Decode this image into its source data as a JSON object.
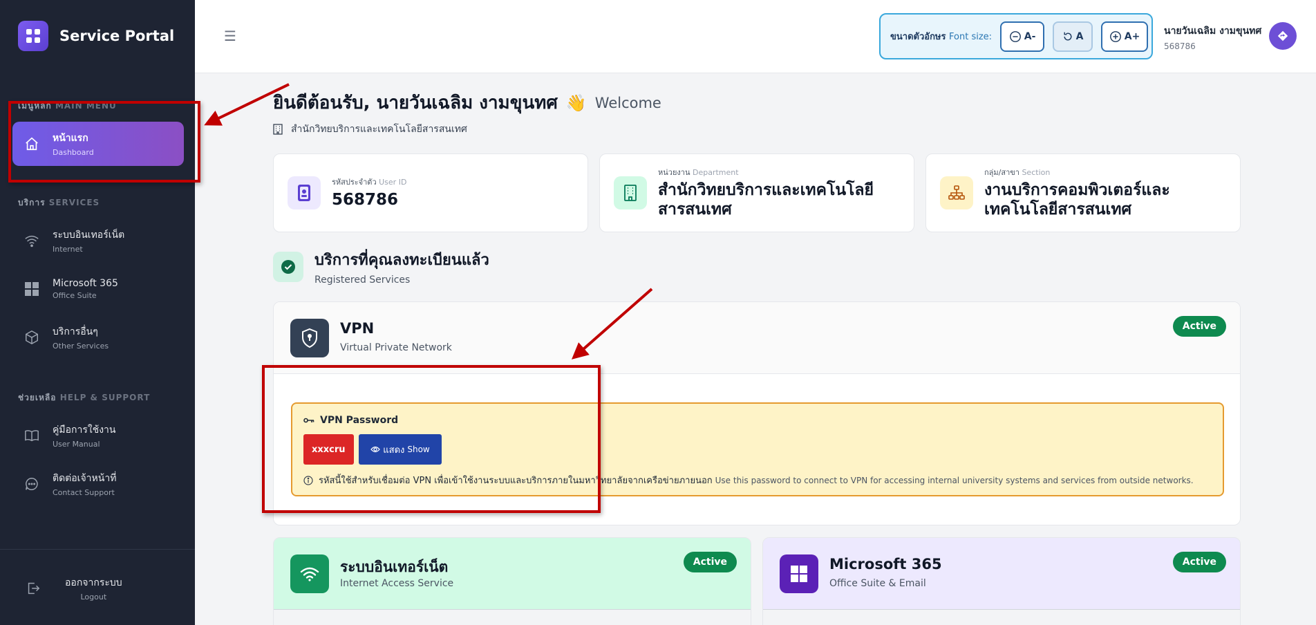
{
  "sidebar": {
    "brand": "Service Portal",
    "main_menu_th": "เมนูหลัก",
    "main_menu_en": "MAIN MENU",
    "services_th": "บริการ",
    "services_en": "SERVICES",
    "help_th": "ช่วยเหลือ",
    "help_en": "HELP & SUPPORT",
    "items": [
      {
        "label": "หน้าแรก",
        "sub": "Dashboard",
        "icon": "home-icon",
        "active": true
      },
      {
        "label": "ระบบอินเทอร์เน็ต",
        "sub": "Internet",
        "icon": "wifi-icon"
      },
      {
        "label": "Microsoft 365",
        "sub": "Office Suite",
        "icon": "windows-icon"
      },
      {
        "label": "บริการอื่นๆ",
        "sub": "Other Services",
        "icon": "box-icon"
      },
      {
        "label": "คู่มือการใช้งาน",
        "sub": "User Manual",
        "icon": "book-icon"
      },
      {
        "label": "ติดต่อเจ้าหน้าที่",
        "sub": "Contact Support",
        "icon": "chat-icon"
      }
    ],
    "logout_label": "ออกจากระบบ",
    "logout_sub": "Logout"
  },
  "header": {
    "font_size_th": "ขนาดตัวอักษร",
    "font_size_en": "Font size:",
    "btn_decrease": "A-",
    "btn_reset": "A",
    "btn_increase": "A+",
    "user_name": "นายวันเฉลิม งามขุนทศ",
    "user_id": "568786"
  },
  "welcome": {
    "title": "ยินดีต้อนรับ, นายวันเฉลิม งามขุนทศ",
    "wave": "👋",
    "en": "Welcome",
    "org": "สำนักวิทยบริการและเทคโนโลยีสารสนเทศ"
  },
  "info_cards": [
    {
      "label_th": "รหัสประจำตัว",
      "label_en": "User ID",
      "value": "568786"
    },
    {
      "label_th": "หน่วยงาน",
      "label_en": "Department",
      "value": "สำนักวิทยบริการและเทคโนโลยีสารสนเทศ"
    },
    {
      "label_th": "กลุ่ม/สาขา",
      "label_en": "Section",
      "value": "งานบริการคอมพิวเตอร์และเทคโนโลยีสารสนเทศ"
    }
  ],
  "registered": {
    "title": "บริการที่คุณลงทะเบียนแล้ว",
    "sub": "Registered Services"
  },
  "vpn": {
    "title": "VPN",
    "sub": "Virtual Private Network",
    "status": "Active",
    "pw_title": "VPN Password",
    "pw_value": "xxxcru",
    "show_th": "แสดง",
    "show_en": "Show",
    "note_th": "รหัสนี้ใช้สำหรับเชื่อมต่อ VPN เพื่อเข้าใช้งานระบบและบริการภายในมหาวิทยาลัยจากเครือข่ายภายนอก",
    "note_en": "Use this password to connect to VPN for accessing internal university systems and services from outside networks."
  },
  "services": [
    {
      "title": "ระบบอินเทอร์เน็ต",
      "sub": "Internet Access Service",
      "status": "Active"
    },
    {
      "title": "Microsoft 365",
      "sub": "Office Suite & Email",
      "status": "Active"
    }
  ],
  "colors": {
    "sidebar_bg": "#1e2433",
    "accent": "#6e5ce8",
    "active_badge": "#0e8a4f",
    "annotation": "#c00000"
  }
}
